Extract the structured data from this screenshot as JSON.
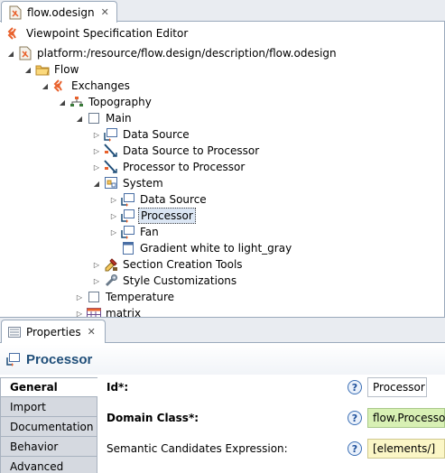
{
  "editor": {
    "tab_label": "flow.odesign",
    "header_title": "Viewpoint Specification Editor"
  },
  "tree": [
    {
      "label": "platform:/resource/flow.design/description/flow.odesign",
      "depth": 0,
      "toggle": "open",
      "icon": "odesign-file-icon"
    },
    {
      "label": "Flow",
      "depth": 1,
      "toggle": "open",
      "icon": "viewpoint-folder-icon"
    },
    {
      "label": "Exchanges",
      "depth": 2,
      "toggle": "open",
      "icon": "exchanges-icon"
    },
    {
      "label": "Topography",
      "depth": 3,
      "toggle": "open",
      "icon": "diagram-description-icon"
    },
    {
      "label": "Main",
      "depth": 4,
      "toggle": "open",
      "icon": "layer-icon"
    },
    {
      "label": "Data Source",
      "depth": 5,
      "toggle": "closed",
      "icon": "node-mapping-icon"
    },
    {
      "label": "Data Source to Processor",
      "depth": 5,
      "toggle": "closed",
      "icon": "edge-mapping-icon"
    },
    {
      "label": "Processor  to Processor",
      "depth": 5,
      "toggle": "closed",
      "icon": "edge-mapping-icon"
    },
    {
      "label": "System",
      "depth": 5,
      "toggle": "open",
      "icon": "container-mapping-icon"
    },
    {
      "label": "Data Source",
      "depth": 6,
      "toggle": "closed",
      "icon": "node-mapping-icon"
    },
    {
      "label": "Processor",
      "depth": 6,
      "toggle": "closed",
      "icon": "node-mapping-icon",
      "selected": true
    },
    {
      "label": "Fan",
      "depth": 6,
      "toggle": "closed",
      "icon": "node-mapping-icon"
    },
    {
      "label": "Gradient  white to light_gray",
      "depth": 6,
      "toggle": "none",
      "icon": "gradient-style-icon"
    },
    {
      "label": "Section Creation Tools",
      "depth": 5,
      "toggle": "closed",
      "icon": "tools-icon"
    },
    {
      "label": "Style Customizations",
      "depth": 5,
      "toggle": "closed",
      "icon": "style-customization-icon"
    },
    {
      "label": "Temperature",
      "depth": 4,
      "toggle": "closed",
      "icon": "layer-icon"
    },
    {
      "label": "matrix",
      "depth": 4,
      "toggle": "closed",
      "icon": "matrix-icon"
    }
  ],
  "properties": {
    "tab_label": "Properties",
    "title": "Processor",
    "side_tabs": [
      "General",
      "Import",
      "Documentation",
      "Behavior",
      "Advanced"
    ],
    "active_side_tab": "General",
    "fields": [
      {
        "label": "Id*:",
        "bold": true,
        "value": "Processor",
        "style": "plain"
      },
      {
        "label": "Domain Class*:",
        "bold": true,
        "value": "flow.Processor",
        "style": "green"
      },
      {
        "label": "Semantic Candidates Expression:",
        "bold": false,
        "value": "[elements/]",
        "style": "yellow"
      }
    ],
    "help_glyph": "?"
  },
  "colors": {
    "accent_orange": "#e8612c",
    "title_blue": "#1f4e79",
    "selection_bg": "#dbe6f4"
  }
}
